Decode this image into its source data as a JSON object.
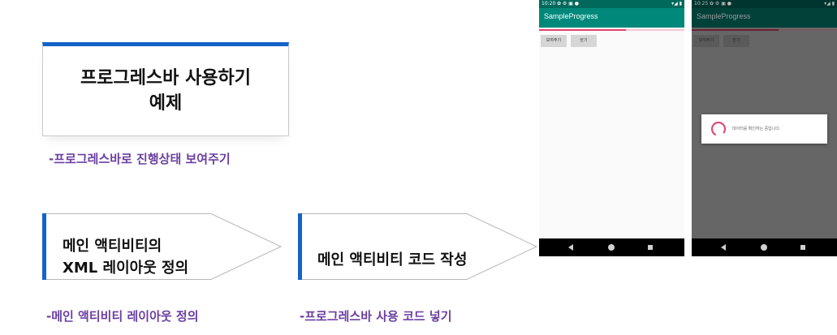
{
  "slide": {
    "title": "프로그레스바 사용하기\n예제",
    "subtitle": "-프로그레스바로 진행상태 보여주기",
    "accent_color": "#1463c8",
    "subtitle_color": "#6b3fa0"
  },
  "steps": [
    {
      "label": "메인 액티비티의\nXML 레이아웃 정의",
      "caption": "-메인 액티비티 레이아웃 정의"
    },
    {
      "label": "메인 액티비티 코드 작성",
      "caption": "-프로그레스바 사용 코드 넣기"
    }
  ],
  "phones": [
    {
      "status_time": "10:20",
      "status_icons": "✿ ⚙ ▣ ●",
      "signal_icons": "▾◢ ▮",
      "app_title": "SampleProgress",
      "appbar_color": "#00897b",
      "progress": 0.6,
      "buttons": [
        "보여주기",
        "닫기"
      ],
      "dim_overlay": false
    },
    {
      "status_time": "10:25",
      "status_icons": "✿ ⚙ ▣ ●",
      "signal_icons": "▾◢ ▮",
      "app_title": "SampleProgress",
      "appbar_color": "#00413a",
      "progress": 0.6,
      "buttons": [
        "보여주기",
        "닫기"
      ],
      "dim_overlay": true,
      "dialog_text": "데이터를 확인하는 중입니다."
    }
  ]
}
